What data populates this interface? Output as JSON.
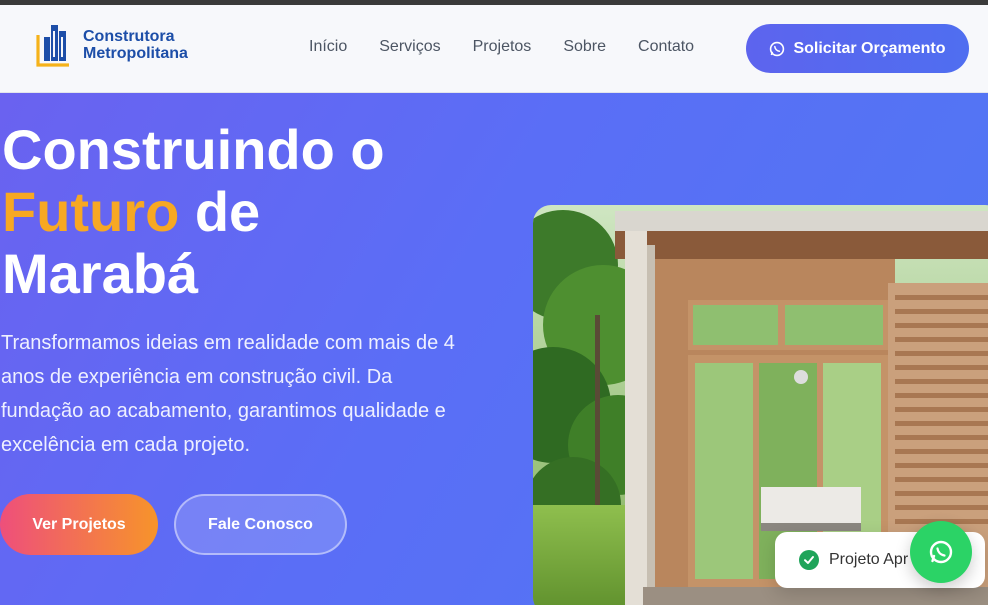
{
  "brand": {
    "name_line1": "Construtora",
    "name_line2": "Metropolitana",
    "logo_icon": "building-logo-icon",
    "primary_color": "#1d4ea8",
    "accent_color": "#f5b21a"
  },
  "nav": {
    "items": [
      {
        "label": "Início"
      },
      {
        "label": "Serviços"
      },
      {
        "label": "Projetos"
      },
      {
        "label": "Sobre"
      },
      {
        "label": "Contato"
      }
    ],
    "cta_label": "Solicitar Orçamento",
    "cta_icon": "whatsapp-icon"
  },
  "hero": {
    "title_line1": "Construindo o",
    "title_accent": "Futuro",
    "title_after_accent": " de",
    "title_line3": "Marabá",
    "description": "Transformamos ideias em realidade com mais de 4 anos de experiência em construção civil. Da fundação ao acabamento, garantimos qualidade e excelência em cada projeto.",
    "btn_primary": "Ver Projetos",
    "btn_secondary": "Fale Conosco",
    "image_alt": "house-photo",
    "accent_color": "#f7a823"
  },
  "status_card": {
    "label": "Projeto Apr",
    "icon": "check-circle-icon",
    "icon_color": "#1fa45a"
  },
  "floating": {
    "icon": "whatsapp-icon",
    "color": "#2bd366"
  }
}
